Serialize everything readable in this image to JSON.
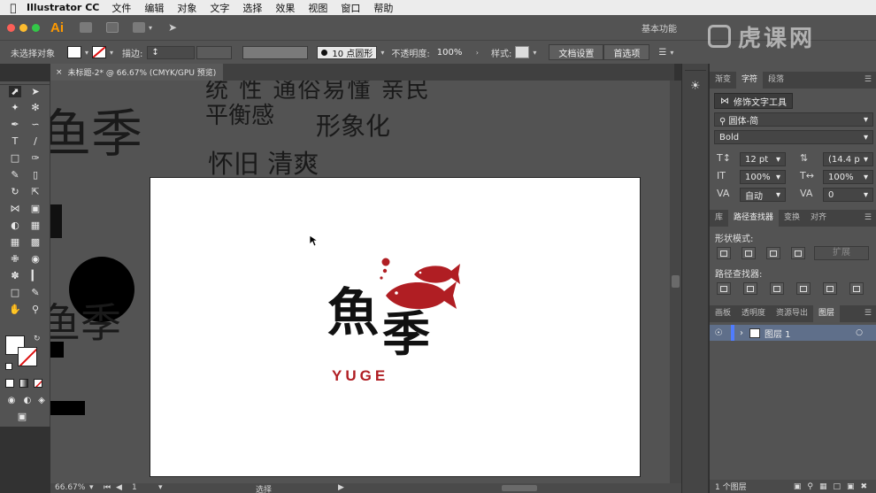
{
  "menubar": {
    "app_name": "Illustrator CC",
    "items": [
      "文件",
      "编辑",
      "对象",
      "文字",
      "选择",
      "效果",
      "视图",
      "窗口",
      "帮助"
    ]
  },
  "appbar": {
    "logo": "Ai",
    "workspace": "基本功能"
  },
  "control_bar": {
    "selection_status": "未选择对象",
    "stroke_label": "描边:",
    "brush_label": "10 点圆形",
    "opacity_label": "不透明度:",
    "opacity_value": "100%",
    "style_label": "样式:",
    "doc_setup_button": "文档设置",
    "prefs_button": "首选项"
  },
  "document_tab": {
    "title": "未标题-2* @ 66.67% (CMYK/GPU 预览)"
  },
  "canvas": {
    "scratch_text": {
      "top_line": "统 性 通俗易懂 亲民",
      "balance": "平衡感",
      "image": "形象化",
      "nostalgic": "怀旧 清爽",
      "left_season_1": "鱼季",
      "left_season_2": "鱼季"
    },
    "logo": {
      "char_fish": "魚",
      "char_season": "季",
      "wordmark": "YUGE",
      "accent_color": "#b01e23",
      "ink_color": "#111111"
    }
  },
  "status_bar": {
    "zoom": "66.67%",
    "artboard_number": "1",
    "tool_status": "选择"
  },
  "character_panel": {
    "tabs": [
      "渐变",
      "字符",
      "段落"
    ],
    "active_tab": "字符",
    "touch_type_tool": "修饰文字工具",
    "font_family": "圆体-简",
    "font_style": "Bold",
    "font_size": "12 pt",
    "leading": "(14.4 p",
    "vertical_scale": "100%",
    "horizontal_scale": "100%",
    "kerning": "自动",
    "tracking": "0"
  },
  "pathfinder_panel": {
    "tabs": [
      "库",
      "路径查找器",
      "变换",
      "对齐"
    ],
    "active_tab": "路径查找器",
    "shape_modes_label": "形状模式:",
    "expand_button": "扩展",
    "pathfinders_label": "路径查找器:"
  },
  "layers_panel": {
    "tabs": [
      "画板",
      "透明度",
      "资源导出",
      "图层"
    ],
    "active_tab": "图层",
    "layer_name": "图层 1",
    "footer_count": "1 个图层",
    "layer_color": "#4f7cff"
  },
  "watermark": {
    "text": "虎课网"
  }
}
